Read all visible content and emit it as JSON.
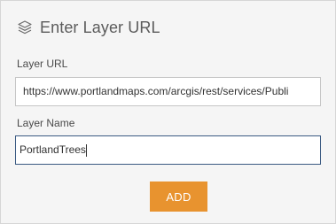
{
  "panel": {
    "title": "Enter Layer URL",
    "title_icon": "layers-icon"
  },
  "form": {
    "layer_url_label": "Layer URL",
    "layer_url_value": "https://www.portlandmaps.com/arcgis/rest/services/Publi",
    "layer_name_label": "Layer Name",
    "layer_name_value": "PortlandTrees"
  },
  "actions": {
    "add_label": "ADD"
  },
  "colors": {
    "panel_background": "#f5f5f5",
    "accent_button": "#e8932f",
    "focused_border": "#3b5a82"
  }
}
